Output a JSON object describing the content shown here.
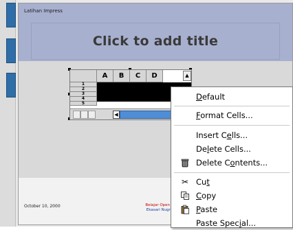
{
  "slide": {
    "presentation_name": "Latihan Impress",
    "title_placeholder": "Click to add title",
    "footer_date": "October 10, 2000",
    "footer_center_line1": "Belajar Open C",
    "footer_center_line2": "Ekasari Nugra"
  },
  "spreadsheet": {
    "columns": [
      "A",
      "B",
      "C",
      "D"
    ],
    "rows": [
      "1",
      "2",
      "3",
      "4",
      "5"
    ],
    "scroll_up_glyph": "▲",
    "scroll_left_glyph": "◀"
  },
  "context_menu": {
    "items": [
      {
        "pre": "",
        "key": "D",
        "post": "efault",
        "icon": ""
      },
      {
        "pre": "",
        "key": "F",
        "post": "ormat Cells...",
        "icon": ""
      },
      {
        "pre": "Insert C",
        "key": "e",
        "post": "lls...",
        "icon": ""
      },
      {
        "pre": "De",
        "key": "l",
        "post": "ete Cells...",
        "icon": ""
      },
      {
        "pre": "Delete C",
        "key": "o",
        "post": "ntents...",
        "icon": "trash-icon"
      },
      {
        "pre": "Cu",
        "key": "t",
        "post": "",
        "icon": "scissors-icon"
      },
      {
        "pre": "",
        "key": "C",
        "post": "opy",
        "icon": "copy-icon"
      },
      {
        "pre": "",
        "key": "P",
        "post": "aste",
        "icon": "paste-icon"
      },
      {
        "pre": "Paste Spec",
        "key": "i",
        "post": "al...",
        "icon": ""
      }
    ]
  },
  "colors": {
    "slide_header": "#a8b0cf",
    "slide_body": "#d9d9d9",
    "side_tab": "#2f6ea8",
    "scroll_thumb": "#4f8ed6",
    "footer_red": "#c40000",
    "footer_blue": "#1c3c9c"
  }
}
